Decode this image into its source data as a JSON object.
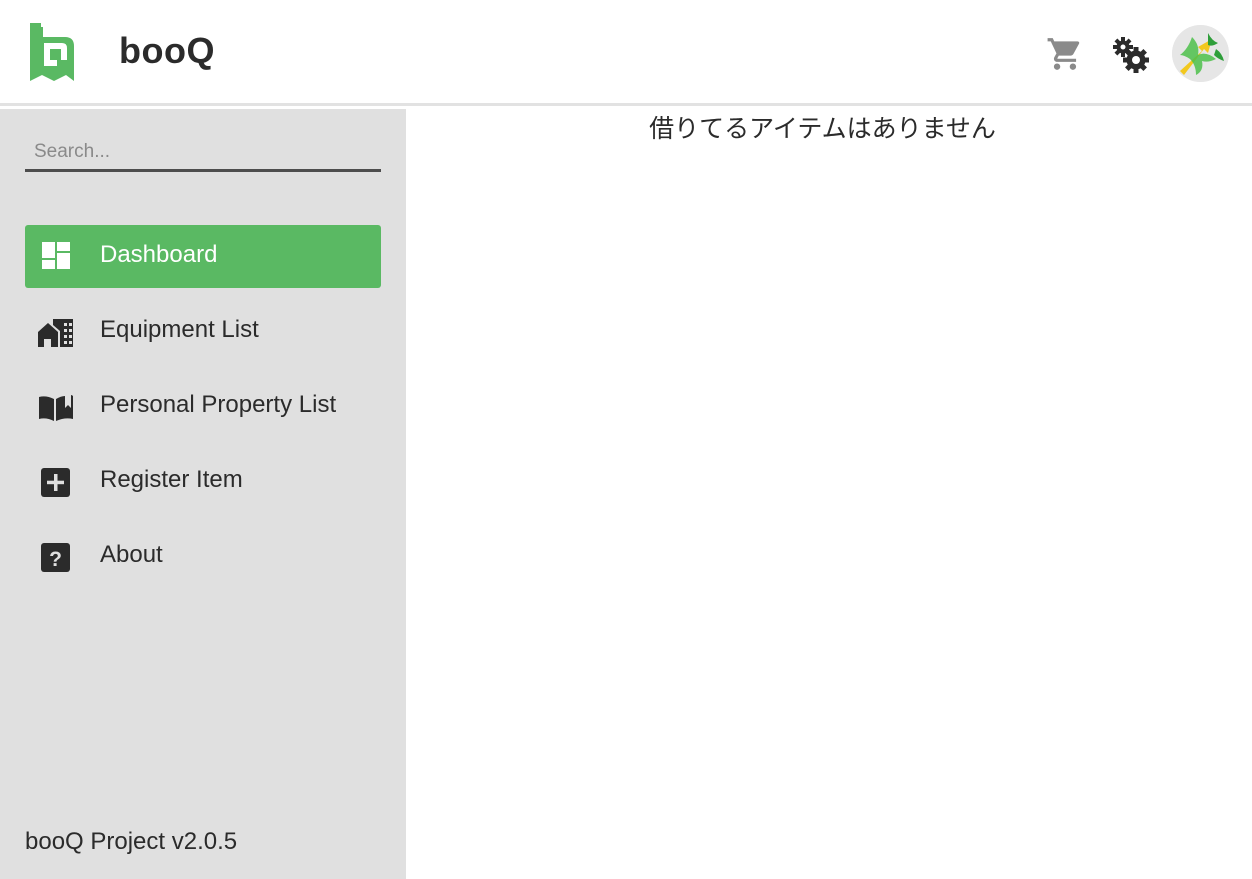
{
  "header": {
    "app_name": "booQ",
    "icons": {
      "logo": "booq-logo",
      "cart": "cart-icon",
      "settings": "gear-icon",
      "avatar": "user-avatar"
    },
    "colors": {
      "brand": "#5ab963",
      "icon_dark": "#2b2b2b",
      "icon_gray": "#8a8a8a"
    }
  },
  "sidebar": {
    "search_placeholder": "Search...",
    "items": [
      {
        "label": "Dashboard",
        "icon": "dashboard-icon",
        "active": true
      },
      {
        "label": "Equipment List",
        "icon": "building-icon",
        "active": false
      },
      {
        "label": "Personal Property List",
        "icon": "book-icon",
        "active": false
      },
      {
        "label": "Register Item",
        "icon": "plus-box-icon",
        "active": false
      },
      {
        "label": "About",
        "icon": "question-box-icon",
        "active": false
      }
    ],
    "version": "booQ Project v2.0.5"
  },
  "main": {
    "empty_message": "借りてるアイテムはありません"
  }
}
